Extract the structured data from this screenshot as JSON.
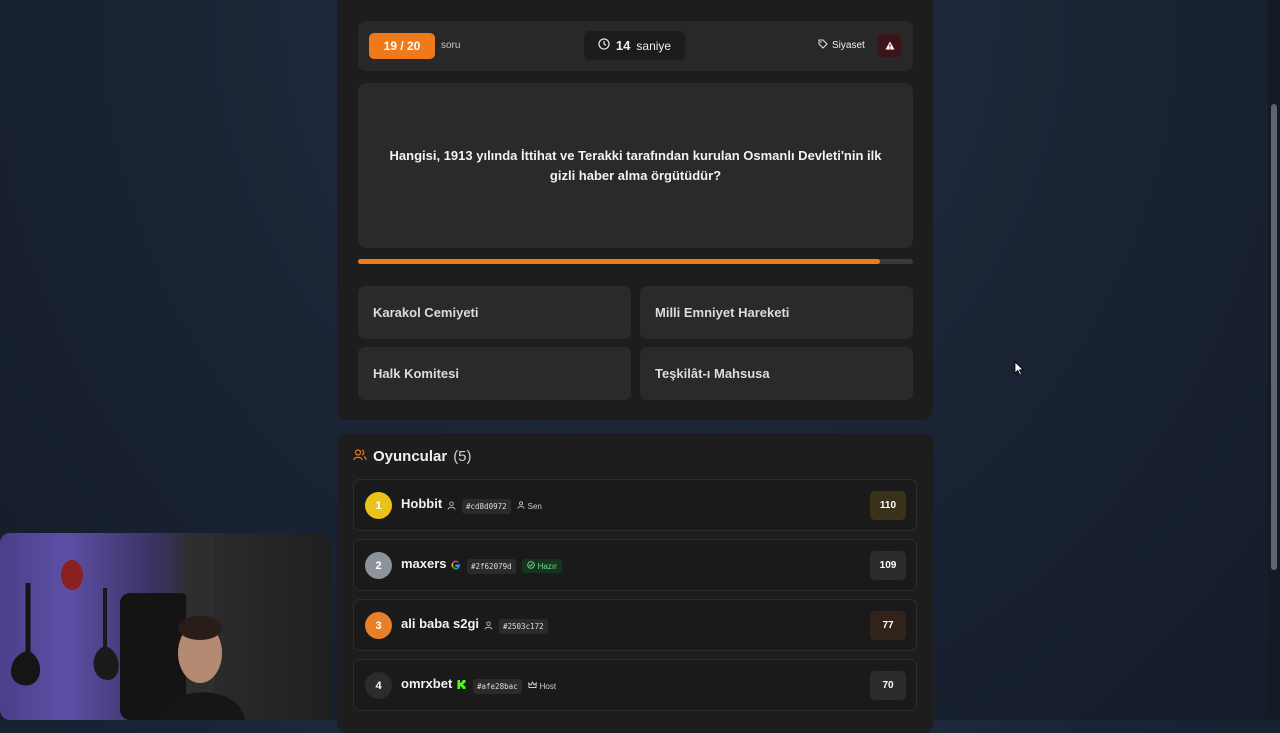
{
  "quiz": {
    "counter": "19 / 20",
    "counter_unit": "soru",
    "timer_value": "14",
    "timer_unit": "saniye",
    "category": "Siyaset",
    "question": "Hangisi, 1913 yılında İttihat ve Terakki tarafından kurulan Osmanlı Devleti'nin ilk gizli haber alma örgütüdür?",
    "time_progress": 0.94,
    "options": [
      "Karakol Cemiyeti",
      "Milli Emniyet Hareketi",
      "Halk Komitesi",
      "Teşkilât-ı Mahsusa"
    ]
  },
  "players": {
    "title": "Oyuncular",
    "count": "(5)",
    "list": [
      {
        "rank": "1",
        "name": "Hobbit",
        "id": "#cd8d0972",
        "badge": "Sen",
        "score": "110"
      },
      {
        "rank": "2",
        "name": "maxers",
        "id": "#2f62079d",
        "badge": "Hazır",
        "score": "109"
      },
      {
        "rank": "3",
        "name": "ali baba s2gi",
        "id": "#2503c172",
        "badge": "",
        "score": "77"
      },
      {
        "rank": "4",
        "name": "omrxbet",
        "id": "#afe28bac",
        "badge": "Host",
        "score": "70"
      }
    ]
  },
  "colors": {
    "accent": "#f07a1a",
    "gold": "#e9c31a",
    "silver": "#8e939b",
    "bronze": "#e8802a"
  }
}
